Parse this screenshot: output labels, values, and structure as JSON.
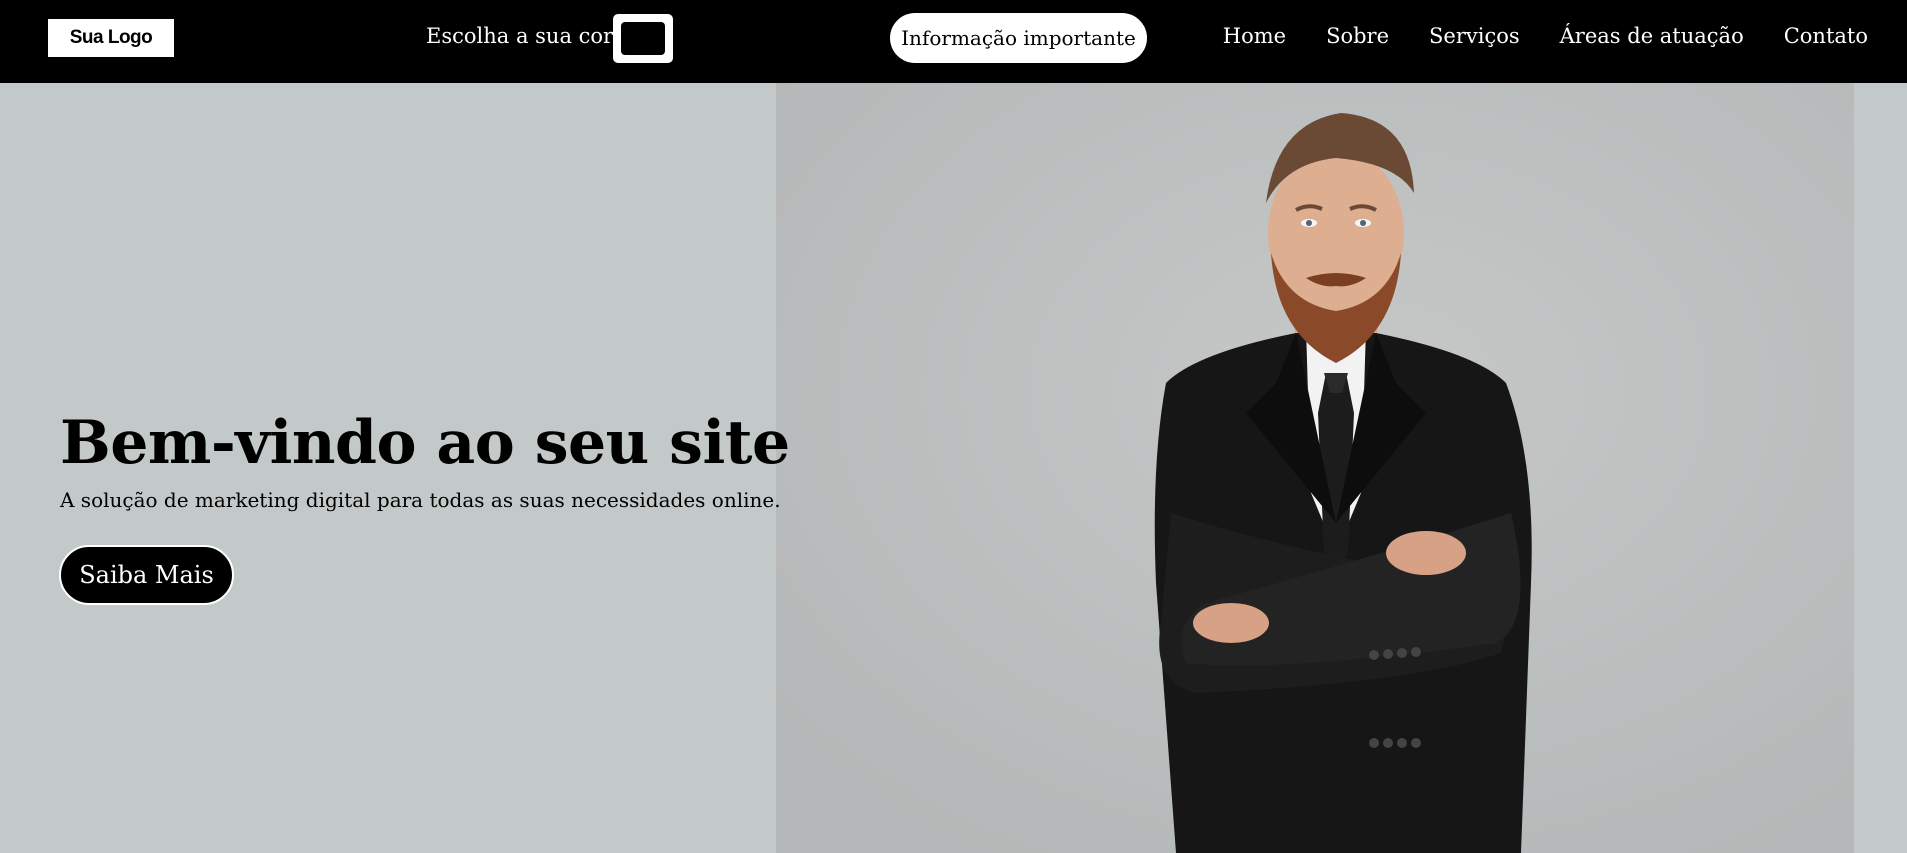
{
  "navbar": {
    "logo_text": "Sua Logo",
    "color_picker_label": "Escolha a sua cor",
    "color_picker_value": "#000000",
    "info_button": "Informação importante",
    "links": [
      "Home",
      "Sobre",
      "Serviços",
      "Áreas de atuação",
      "Contato"
    ]
  },
  "hero": {
    "title": "Bem-vindo ao seu site",
    "subtitle": "A solução de marketing digital para todas as suas necessidades online.",
    "cta_label": "Saiba Mais",
    "image_alt": "man in black suit with arms crossed"
  },
  "colors": {
    "navbar_bg": "#000000",
    "hero_bg": "#c3c9c9",
    "accent": "#000000"
  }
}
